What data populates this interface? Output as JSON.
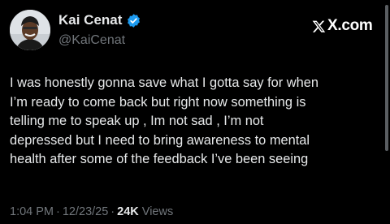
{
  "author": {
    "display_name": "Kai Cenat",
    "handle": "@KaiCenat",
    "verified": true
  },
  "brand": {
    "text": "X.com",
    "logo_icon": "x-logo-icon"
  },
  "tweet": {
    "lines": [
      "I was honestly gonna save what I gotta say for when",
      "I’m ready to come back but right now something is",
      "telling me to speak up , Im not sad , I’m not",
      "depressed but I need to bring awareness to mental",
      "health after some of the feedback I’ve been seeing"
    ]
  },
  "meta": {
    "time": "1:04 PM",
    "separator": "·",
    "date": "12/23/25",
    "views_count": "24K",
    "views_label": "Views"
  },
  "colors": {
    "background": "#000000",
    "text_primary": "#e7e9ea",
    "text_secondary": "#71767b",
    "verified_badge": "#1d9bf0"
  }
}
